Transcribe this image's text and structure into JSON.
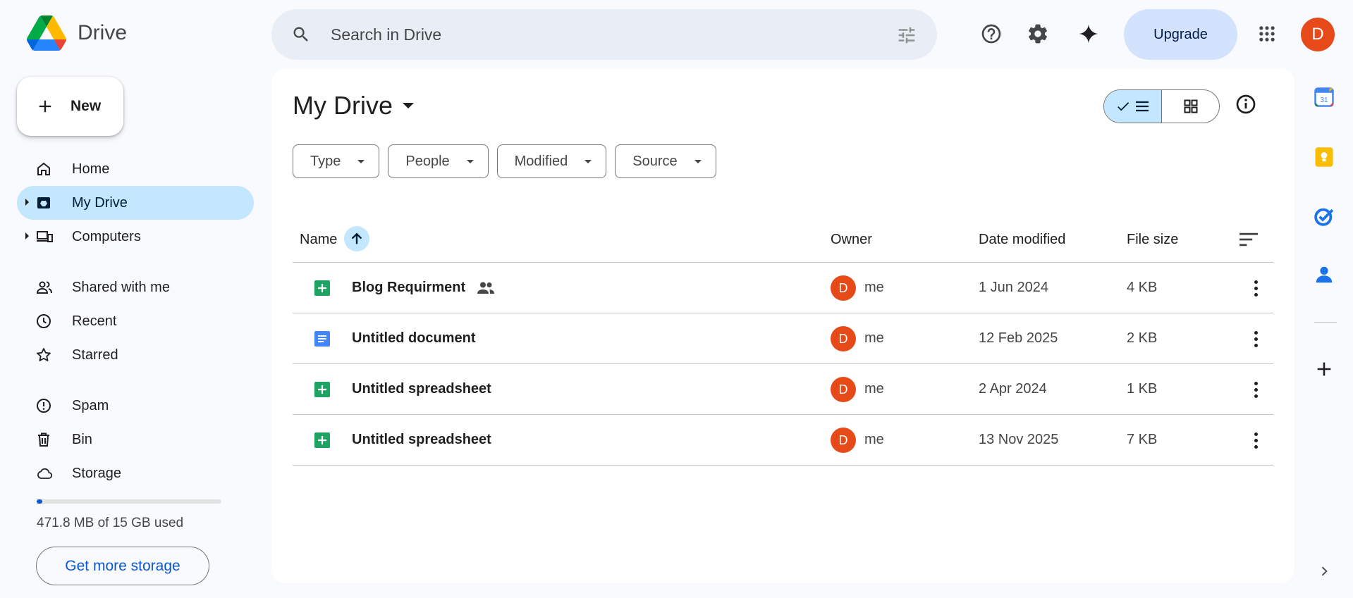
{
  "header": {
    "logo_text": "Drive",
    "search_placeholder": "Search in Drive",
    "upgrade_label": "Upgrade",
    "avatar_letter": "D"
  },
  "sidebar": {
    "new_label": "New",
    "items": [
      {
        "label": "Home",
        "icon": "home-icon"
      },
      {
        "label": "My Drive",
        "icon": "my-drive-icon",
        "active": true
      },
      {
        "label": "Computers",
        "icon": "computers-icon"
      },
      {
        "label": "Shared with me",
        "icon": "shared-icon"
      },
      {
        "label": "Recent",
        "icon": "clock-icon"
      },
      {
        "label": "Starred",
        "icon": "star-icon"
      },
      {
        "label": "Spam",
        "icon": "spam-icon"
      },
      {
        "label": "Bin",
        "icon": "bin-icon"
      },
      {
        "label": "Storage",
        "icon": "cloud-icon"
      }
    ],
    "storage_text": "471.8 MB of 15 GB used",
    "storage_fraction": 0.031,
    "get_more_storage": "Get more storage"
  },
  "main": {
    "title": "My Drive",
    "filters": [
      "Type",
      "People",
      "Modified",
      "Source"
    ],
    "columns": {
      "name": "Name",
      "owner": "Owner",
      "date": "Date modified",
      "size": "File size"
    },
    "files": [
      {
        "name": "Blog Requirment",
        "type": "sheet",
        "shared": true,
        "owner_letter": "D",
        "owner": "me",
        "date": "1 Jun 2024",
        "size": "4 KB"
      },
      {
        "name": "Untitled document",
        "type": "doc",
        "shared": false,
        "owner_letter": "D",
        "owner": "me",
        "date": "12 Feb 2025",
        "size": "2 KB"
      },
      {
        "name": "Untitled spreadsheet",
        "type": "sheet",
        "shared": false,
        "owner_letter": "D",
        "owner": "me",
        "date": "2 Apr 2024",
        "size": "1 KB"
      },
      {
        "name": "Untitled spreadsheet",
        "type": "sheet",
        "shared": false,
        "owner_letter": "D",
        "owner": "me",
        "date": "13 Nov 2025",
        "size": "7 KB"
      }
    ]
  },
  "rail": {
    "calendar_day": "31"
  },
  "colors": {
    "accent": "#0b57d0",
    "active_bg": "#c2e7ff",
    "avatar": "#e64a19",
    "sheets_green": "#1ea362",
    "docs_blue": "#4285f4"
  }
}
